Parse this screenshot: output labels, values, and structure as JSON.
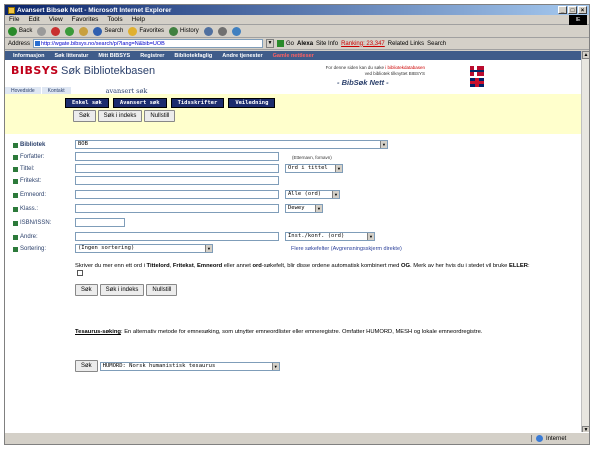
{
  "window": {
    "title": "Avansert Bibsøk Nett - Microsoft Internet Explorer",
    "controls": [
      "_",
      "□",
      "×"
    ],
    "winlogo": "IE"
  },
  "menu": [
    "File",
    "Edit",
    "View",
    "Favorites",
    "Tools",
    "Help"
  ],
  "toolbar": {
    "back": "Back",
    "search": "Search",
    "favorites": "Favorites",
    "history": "History"
  },
  "address": {
    "label": "Address",
    "url": "http://wgate.bibsys.no/search/pi?lang=N&bib=UOB",
    "go": "Go",
    "alexa": "Alexa",
    "site_info": "Site Info",
    "ranking": "Ranking: 23,347",
    "related": "Related Links",
    "search": "Search"
  },
  "nav": {
    "items": [
      "Informasjon",
      "Søk litteratur",
      "Mitt BIBSYS",
      "Registrer",
      "Bibliotekfaglig",
      "Andre tjenester",
      "Gamle nettleser"
    ]
  },
  "header": {
    "logo": "BIBSYS",
    "title": "Søk Bibliotekbasen",
    "note_line1": "For denne siden kan du søke",
    "note_red": "i bibliotekdatabasen",
    "note_line2": "ved bibliotek tilknyttet BIBSYS",
    "brand": "- BibSøk Nett -",
    "tabs": [
      "Hovedside",
      "Kontakt"
    ],
    "current": "avansert søk"
  },
  "modes": [
    "Enkel søk",
    "Avansert søk",
    "Tidsskrifter",
    "Veiledning"
  ],
  "actions": {
    "search": "Søk",
    "search_index": "Søk i indeks",
    "reset": "Nullstill"
  },
  "form": {
    "library": {
      "label": "Bibliotek",
      "value": "BOB"
    },
    "author": {
      "label": "Forfatter:",
      "hint": "(Etternavn, fornavn)"
    },
    "title": {
      "label": "Tittel:",
      "select": "Ord i tittel"
    },
    "freetext": {
      "label": "Fritekst:"
    },
    "subject": {
      "label": "Emneord:",
      "select": "Alle (ord)"
    },
    "class": {
      "label": "Klass.:",
      "select": "Dewey"
    },
    "isbn": {
      "label": "ISBN/ISSN:"
    },
    "other": {
      "label": "Andre:",
      "select": "Inst./konf. (ord)",
      "link": "Flere søkefelter (Avgrensningsskjerm direkte)"
    },
    "sort": {
      "label": "Sortering:",
      "select": "(Ingen sortering)"
    }
  },
  "paragraph": {
    "t1": "Skriver du mer enn ett ord i ",
    "b1": "Tittelord",
    "t2": ", ",
    "b2": "Fritekst",
    "t3": ", ",
    "b3": "Emneord",
    "t4": " eller annet ",
    "b4": "ord",
    "t5": "-søkefelt, blir disse ordene automatisk kombinert med ",
    "b5": "OG",
    "t6": ". Merk av her hvis du i stedet vil bruke ",
    "b6": "ELLER",
    "t7": ":"
  },
  "tesaurus": {
    "title": "Tesaurus-søking",
    "text": ": En alternativ metode for emnesøking, som utnytter emneordlister eller emneregistre. Omfatter HUMORD, MESH og lokale emneordregistre.",
    "button": "Søk",
    "select": "HUMORD: Norsk humanistisk tesaurus"
  },
  "status": {
    "left": "",
    "zone": "Internet"
  }
}
